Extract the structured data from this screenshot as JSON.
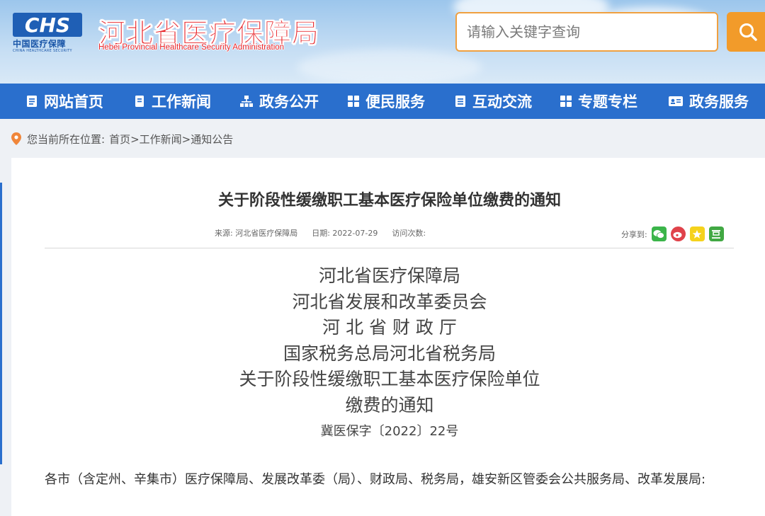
{
  "header": {
    "logo_mark": "CHS",
    "logo_cn": "中国医疗保障",
    "logo_en": "CHINA HEALTHCARE SECURITY",
    "site_title": "河北省医疗保障局",
    "site_subtitle": "Hebei Provincial Healthcare Security Administration",
    "search_placeholder": "请输入关键字查询",
    "search_icon": "search-icon"
  },
  "nav": {
    "items": [
      {
        "label": "网站首页",
        "icon": "home-doc-icon"
      },
      {
        "label": "工作新闻",
        "icon": "bookmark-doc-icon"
      },
      {
        "label": "政务公开",
        "icon": "org-tree-icon"
      },
      {
        "label": "便民服务",
        "icon": "grid-icon"
      },
      {
        "label": "互动交流",
        "icon": "doc-lines-icon"
      },
      {
        "label": "专题专栏",
        "icon": "grid-icon"
      },
      {
        "label": "政务服务",
        "icon": "id-card-icon"
      }
    ]
  },
  "breadcrumb": {
    "prefix": "您当前所在位置:",
    "path": "首页>工作新闻>通知公告"
  },
  "article": {
    "title": "关于阶段性缓缴职工基本医疗保险单位缴费的通知",
    "meta": {
      "source": "来源:  河北省医疗保障局",
      "date": "日期:  2022-07-29",
      "visits": "访问次数:"
    },
    "share_label": "分享到:",
    "share_icons": [
      "wechat-icon",
      "weibo-icon",
      "qzone-icon",
      "douban-icon"
    ],
    "doc_head": {
      "line1": "河北省医疗保障局",
      "line2": "河北省发展和改革委员会",
      "line3": "河 北 省 财 政 厅",
      "line4": "国家税务总局河北省税务局",
      "line5": "关于阶段性缓缴职工基本医疗保险单位",
      "line6": "缴费的通知",
      "number": "冀医保字〔2022〕22号"
    },
    "body": "各市（含定州、辛集市）医疗保障局、发展改革委（局）、财政局、税务局，雄安新区管委会公共服务局、改革发展局:"
  },
  "colors": {
    "nav_bg": "#2a6fcd",
    "title_red": "#e8262b",
    "search_orange": "#f29b2a"
  }
}
